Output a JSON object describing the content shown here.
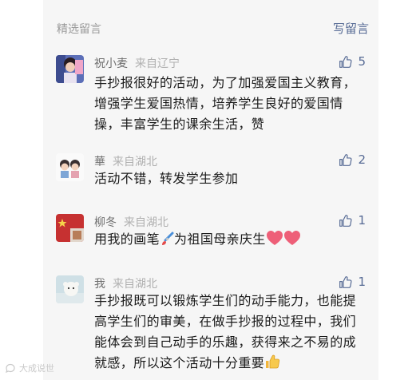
{
  "section": {
    "title": "精选留言",
    "write_label": "写留言"
  },
  "comments": [
    {
      "nickname": "祝小麦",
      "location": "来自辽宁",
      "likes": "5",
      "text": "手抄报很好的活动，为了加强爱国主义教育，增强学生爱国热情，培养学生良好的爱国情操，丰富学生的课余生活，赞"
    },
    {
      "nickname": "華",
      "location": "来自湖北",
      "likes": "2",
      "text": "活动不错，转发学生参加"
    },
    {
      "nickname": "柳冬",
      "location": "来自湖北",
      "likes": "1",
      "text_before": "用我的画笔",
      "text_after": "为祖国母亲庆生",
      "emojis": [
        "paintbrush-emoji",
        "heart-emoji",
        "heart-emoji"
      ]
    },
    {
      "nickname": "我",
      "location": "来自湖北",
      "likes": "1",
      "text": "手抄报既可以锻炼学生们的动手能力，也能提高学生们的审美，在做手抄报的过程中，我们能体会到自己动手的乐趣，获得来之不易的成就感，所以这个活动十分重要",
      "emoji": "thumbs-up-emoji"
    }
  ],
  "watermark": {
    "text": "大成说世",
    "icon": "watermark-logo-icon"
  },
  "colors": {
    "link": "#576b95",
    "panel": "#f6f6f6",
    "heart": "#ee5f78"
  }
}
